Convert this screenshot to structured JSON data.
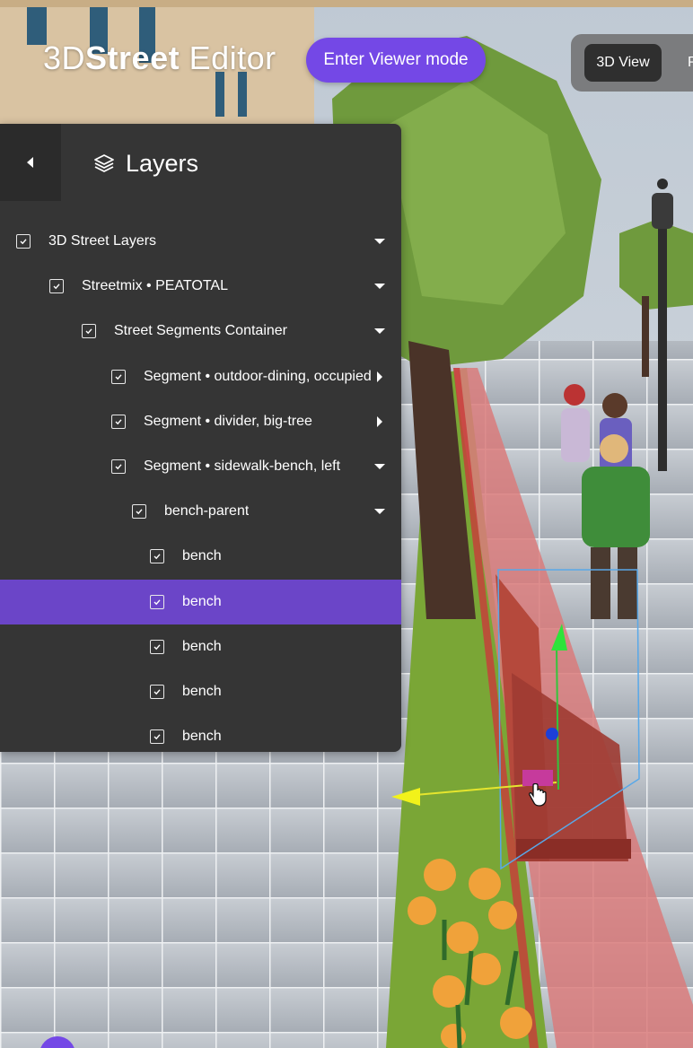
{
  "app": {
    "title_part1": "3D",
    "title_part2": "Street",
    "title_part3": " Editor",
    "viewer_button": "Enter Viewer mode"
  },
  "view_toggle": {
    "active": "3D View",
    "next": "P"
  },
  "layers_panel": {
    "title": "Layers",
    "items": [
      {
        "label": "3D Street Layers",
        "depth": 0,
        "expanded": true
      },
      {
        "label": "Streetmix • PEATOTAL",
        "depth": 1,
        "expanded": true
      },
      {
        "label": "Street Segments Container",
        "depth": 2,
        "expanded": true
      },
      {
        "label": "Segment • outdoor-dining, occupied",
        "depth": 3,
        "expanded": false
      },
      {
        "label": "Segment • divider, big-tree",
        "depth": 3,
        "expanded": false
      },
      {
        "label": "Segment • sidewalk-bench, left",
        "depth": 3,
        "expanded": true
      },
      {
        "label": "bench-parent",
        "depth": 4,
        "expanded": true
      },
      {
        "label": "bench",
        "depth": 5
      },
      {
        "label": "bench",
        "depth": 5,
        "selected": true
      },
      {
        "label": "bench",
        "depth": 5
      },
      {
        "label": "bench",
        "depth": 5
      },
      {
        "label": "bench",
        "depth": 5
      }
    ]
  },
  "colors": {
    "accent": "#7448e6",
    "selected_row": "#6b45c8",
    "panel_bg": "#353535"
  }
}
